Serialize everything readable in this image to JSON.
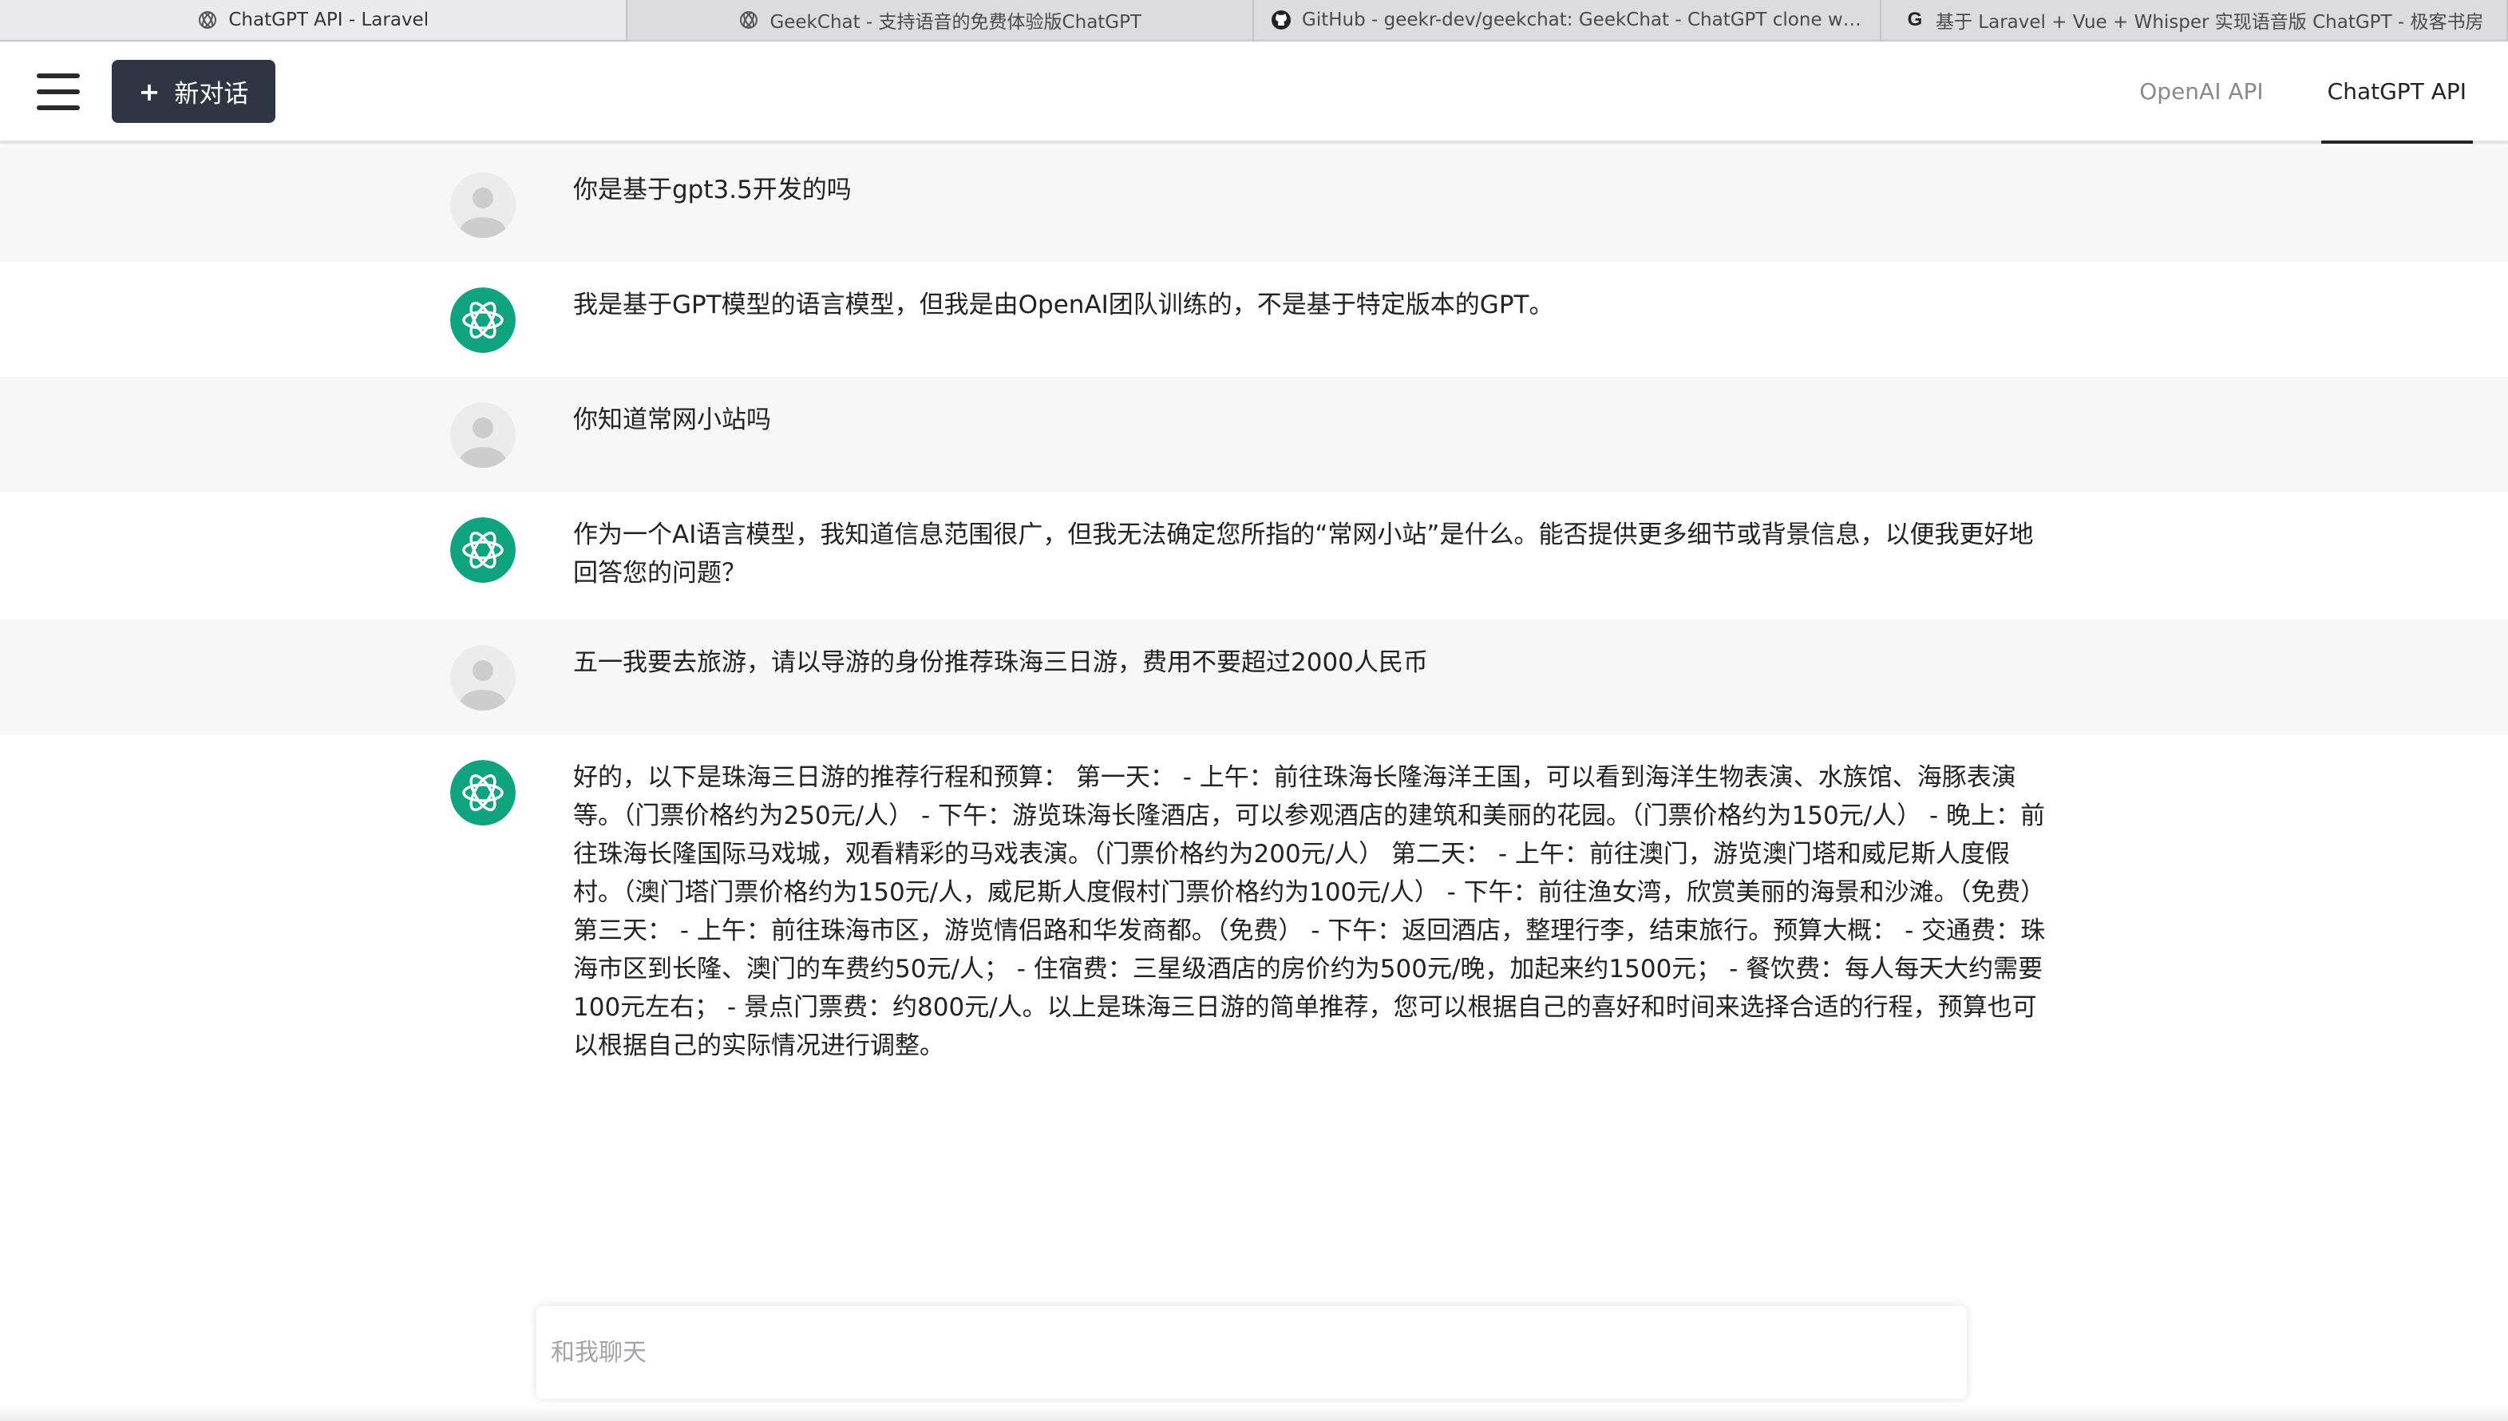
{
  "browser": {
    "tabs": [
      {
        "title": "ChatGPT API - Laravel",
        "icon": "openai-icon",
        "active": true
      },
      {
        "title": "GeekChat - 支持语音的免费体验版ChatGPT",
        "icon": "openai-icon",
        "active": false
      },
      {
        "title": "GitHub - geekr-dev/geekchat: GeekChat - ChatGPT clone wit...",
        "icon": "github-icon",
        "active": false
      },
      {
        "title": "基于 Laravel + Vue + Whisper 实现语音版 ChatGPT - 极客书房",
        "icon": "g-letter-icon",
        "active": false
      }
    ]
  },
  "header": {
    "new_chat_plus": "+",
    "new_chat_label": "新对话",
    "nav": [
      {
        "label": "OpenAI API",
        "active": false
      },
      {
        "label": "ChatGPT API",
        "active": true
      }
    ]
  },
  "messages": [
    {
      "role": "user",
      "text": "你是基于gpt3.5开发的吗"
    },
    {
      "role": "assistant",
      "text": "我是基于GPT模型的语言模型，但我是由OpenAI团队训练的，不是基于特定版本的GPT。"
    },
    {
      "role": "user",
      "text": "你知道常网小站吗"
    },
    {
      "role": "assistant",
      "text": "作为一个AI语言模型，我知道信息范围很广，但我无法确定您所指的“常网小站”是什么。能否提供更多细节或背景信息，以便我更好地回答您的问题？"
    },
    {
      "role": "user",
      "text": "五一我要去旅游，请以导游的身份推荐珠海三日游，费用不要超过2000人民币"
    },
    {
      "role": "assistant",
      "text": "好的，以下是珠海三日游的推荐行程和预算： 第一天： - 上午：前往珠海长隆海洋王国，可以看到海洋生物表演、水族馆、海豚表演等。（门票价格约为250元/人） - 下午：游览珠海长隆酒店，可以参观酒店的建筑和美丽的花园。（门票价格约为150元/人） - 晚上：前往珠海长隆国际马戏城，观看精彩的马戏表演。（门票价格约为200元/人） 第二天： - 上午：前往澳门，游览澳门塔和威尼斯人度假村。（澳门塔门票价格约为150元/人，威尼斯人度假村门票价格约为100元/人） - 下午：前往渔女湾，欣赏美丽的海景和沙滩。（免费） 第三天： - 上午：前往珠海市区，游览情侣路和华发商都。（免费） - 下午：返回酒店，整理行李，结束旅行。预算大概： - 交通费：珠海市区到长隆、澳门的车费约50元/人； - 住宿费：三星级酒店的房价约为500元/晚，加起来约1500元； - 餐饮费：每人每天大约需要100元左右； - 景点门票费：约800元/人。以上是珠海三日游的简单推荐，您可以根据自己的喜好和时间来选择合适的行程，预算也可以根据自己的实际情况进行调整。"
    }
  ],
  "composer": {
    "placeholder": "和我聊天"
  },
  "colors": {
    "accent_dark": "#2f3542",
    "assistant_avatar": "#10a37f",
    "user_row_bg": "#f7f7f8"
  }
}
